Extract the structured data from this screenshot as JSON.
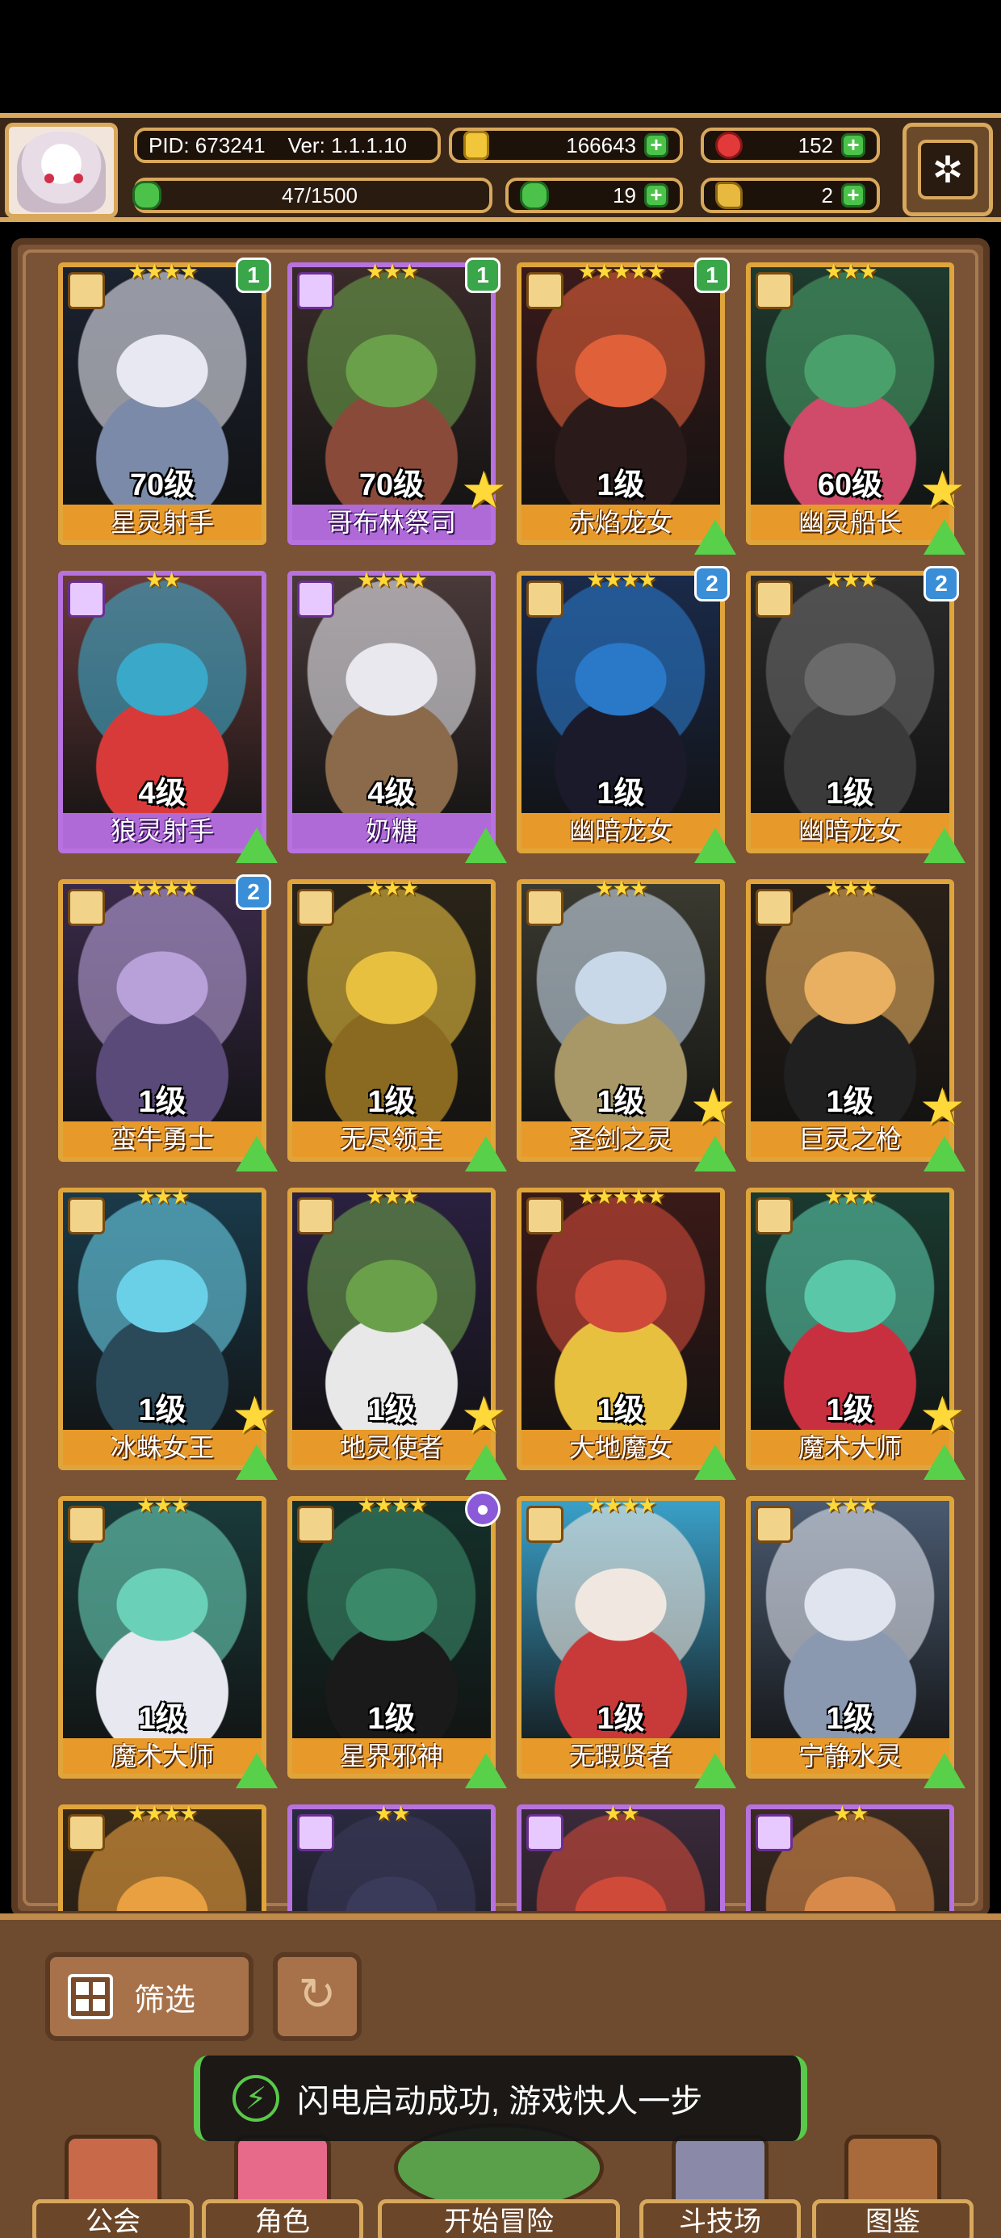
{
  "header": {
    "pid": "PID: 673241",
    "version": "Ver: 1.1.1.10",
    "gold": "166643",
    "gems": "152",
    "energy": "47/1500",
    "clover": "19",
    "keys": "2"
  },
  "heroes": [
    {
      "name": "星灵射手",
      "level": "70级",
      "stars": "★★★★",
      "rarity": "gold",
      "badge": "1",
      "badge_color": "g",
      "star_mark": false,
      "upgrade": false,
      "art": [
        "#1b2230",
        "#e8e8f2",
        "#7a8aa8"
      ]
    },
    {
      "name": "哥布林祭司",
      "level": "70级",
      "stars": "★★★",
      "rarity": "purple",
      "badge": "1",
      "badge_color": "g",
      "star_mark": true,
      "upgrade": false,
      "art": [
        "#3a2a2a",
        "#6aa04a",
        "#8a4a3a"
      ]
    },
    {
      "name": "赤焰龙女",
      "level": "1级",
      "stars": "★★★★★",
      "rarity": "gold",
      "badge": "1",
      "badge_color": "g",
      "star_mark": false,
      "upgrade": true,
      "art": [
        "#3a1a1a",
        "#e0603a",
        "#2a1a1a"
      ]
    },
    {
      "name": "幽灵船长",
      "level": "60级",
      "stars": "★★★",
      "rarity": "gold",
      "badge": "",
      "badge_color": "",
      "star_mark": true,
      "upgrade": true,
      "art": [
        "#1e3a2e",
        "#4aa06a",
        "#d04a6a"
      ]
    },
    {
      "name": "狼灵射手",
      "level": "4级",
      "stars": "★★",
      "rarity": "purple",
      "badge": "",
      "badge_color": "",
      "star_mark": false,
      "upgrade": true,
      "art": [
        "#6a3a3a",
        "#3aa8c8",
        "#d83a3a"
      ]
    },
    {
      "name": "奶糖",
      "level": "4级",
      "stars": "★★★★",
      "rarity": "purple",
      "badge": "",
      "badge_color": "",
      "star_mark": false,
      "upgrade": true,
      "art": [
        "#4a3a3a",
        "#e8e8ee",
        "#8a6a4a"
      ]
    },
    {
      "name": "幽暗龙女",
      "level": "1级",
      "stars": "★★★★",
      "rarity": "gold",
      "badge": "2",
      "badge_color": "b",
      "star_mark": false,
      "upgrade": true,
      "art": [
        "#1a2a4a",
        "#2a78c8",
        "#1a1a2a"
      ]
    },
    {
      "name": "幽暗龙女",
      "level": "1级",
      "stars": "★★★",
      "rarity": "gold",
      "badge": "2",
      "badge_color": "b",
      "star_mark": false,
      "upgrade": true,
      "art": [
        "#2a2a2a",
        "#6a6a6a",
        "#3a3a3a"
      ]
    },
    {
      "name": "蛮牛勇士",
      "level": "1级",
      "stars": "★★★★",
      "rarity": "gold",
      "badge": "2",
      "badge_color": "b",
      "star_mark": false,
      "upgrade": true,
      "art": [
        "#3a2a4a",
        "#b8a0d8",
        "#5a4a7a"
      ]
    },
    {
      "name": "无尽领主",
      "level": "1级",
      "stars": "★★★",
      "rarity": "gold",
      "badge": "",
      "badge_color": "",
      "star_mark": false,
      "upgrade": true,
      "art": [
        "#2a2418",
        "#e8c040",
        "#8a6a20"
      ]
    },
    {
      "name": "圣剑之灵",
      "level": "1级",
      "stars": "★★★",
      "rarity": "gold",
      "badge": "",
      "badge_color": "",
      "star_mark": true,
      "upgrade": true,
      "art": [
        "#3a3a30",
        "#c8d8e8",
        "#a89868"
      ]
    },
    {
      "name": "巨灵之枪",
      "level": "1级",
      "stars": "★★★",
      "rarity": "gold",
      "badge": "",
      "badge_color": "",
      "star_mark": true,
      "upgrade": true,
      "art": [
        "#2a2018",
        "#e8b060",
        "#202020"
      ]
    },
    {
      "name": "冰蛛女王",
      "level": "1级",
      "stars": "★★★",
      "rarity": "gold",
      "badge": "",
      "badge_color": "",
      "star_mark": true,
      "upgrade": true,
      "art": [
        "#1a3a4a",
        "#6ad0e8",
        "#2a4a5a"
      ]
    },
    {
      "name": "地灵使者",
      "level": "1级",
      "stars": "★★★",
      "rarity": "gold",
      "badge": "",
      "badge_color": "",
      "star_mark": true,
      "upgrade": true,
      "art": [
        "#2a2040",
        "#6aa04a",
        "#e8e8e8"
      ]
    },
    {
      "name": "大地魔女",
      "level": "1级",
      "stars": "★★★★★",
      "rarity": "gold",
      "badge": "",
      "badge_color": "",
      "star_mark": false,
      "upgrade": true,
      "art": [
        "#3a1a18",
        "#d04a3a",
        "#e8c040"
      ]
    },
    {
      "name": "魔术大师",
      "level": "1级",
      "stars": "★★★",
      "rarity": "gold",
      "badge": "",
      "badge_color": "",
      "star_mark": true,
      "upgrade": true,
      "art": [
        "#1a3a30",
        "#5ac8a8",
        "#c83040"
      ]
    },
    {
      "name": "魔术大师",
      "level": "1级",
      "stars": "★★★",
      "rarity": "gold",
      "badge": "",
      "badge_color": "",
      "star_mark": false,
      "upgrade": true,
      "art": [
        "#1a3a3a",
        "#6ad0b8",
        "#e8e8f0"
      ]
    },
    {
      "name": "星界邪神",
      "level": "1级",
      "stars": "★★★★",
      "rarity": "gold",
      "badge": "●",
      "badge_color": "p",
      "star_mark": false,
      "upgrade": true,
      "art": [
        "#14302a",
        "#3a8a6a",
        "#1a1a1a"
      ]
    },
    {
      "name": "无瑕贤者",
      "level": "1级",
      "stars": "★★★★",
      "rarity": "gold",
      "badge": "",
      "badge_color": "",
      "star_mark": false,
      "upgrade": true,
      "art": [
        "#3aa0c8",
        "#f0e8e0",
        "#c83a3a"
      ]
    },
    {
      "name": "宁静水灵",
      "level": "1级",
      "stars": "★★★",
      "rarity": "gold",
      "badge": "",
      "badge_color": "",
      "star_mark": false,
      "upgrade": true,
      "art": [
        "#4a5a70",
        "#e0e4ee",
        "#8a98b0"
      ]
    },
    {
      "name": "",
      "level": "",
      "stars": "★★★★",
      "rarity": "gold",
      "badge": "",
      "badge_color": "",
      "star_mark": false,
      "upgrade": false,
      "art": [
        "#3a2a18",
        "#e8a040",
        "#c84a2a"
      ]
    },
    {
      "name": "",
      "level": "",
      "stars": "★★",
      "rarity": "purple",
      "badge": "",
      "badge_color": "",
      "star_mark": false,
      "upgrade": false,
      "art": [
        "#2a2a40",
        "#3a3a5a",
        "#6aa04a"
      ]
    },
    {
      "name": "",
      "level": "",
      "stars": "★★",
      "rarity": "purple",
      "badge": "",
      "badge_color": "",
      "star_mark": false,
      "upgrade": false,
      "art": [
        "#3a2a3a",
        "#d04a3a",
        "#2a2a2a"
      ]
    },
    {
      "name": "",
      "level": "",
      "stars": "★★",
      "rarity": "purple",
      "badge": "",
      "badge_color": "",
      "star_mark": false,
      "upgrade": false,
      "art": [
        "#3a2a20",
        "#d88a4a",
        "#e0b060"
      ]
    }
  ],
  "controls": {
    "filter_label": "筛选"
  },
  "toast": {
    "message": "闪电启动成功, 游戏快人一步"
  },
  "nav": [
    {
      "label": "公会",
      "color": "#c86a4a"
    },
    {
      "label": "角色",
      "color": "#e86a8a"
    },
    {
      "label": "开始冒险",
      "color": "#5aa04a"
    },
    {
      "label": "斗技场",
      "color": "#8a8aa8"
    },
    {
      "label": "图鉴",
      "color": "#a86a3a"
    }
  ]
}
